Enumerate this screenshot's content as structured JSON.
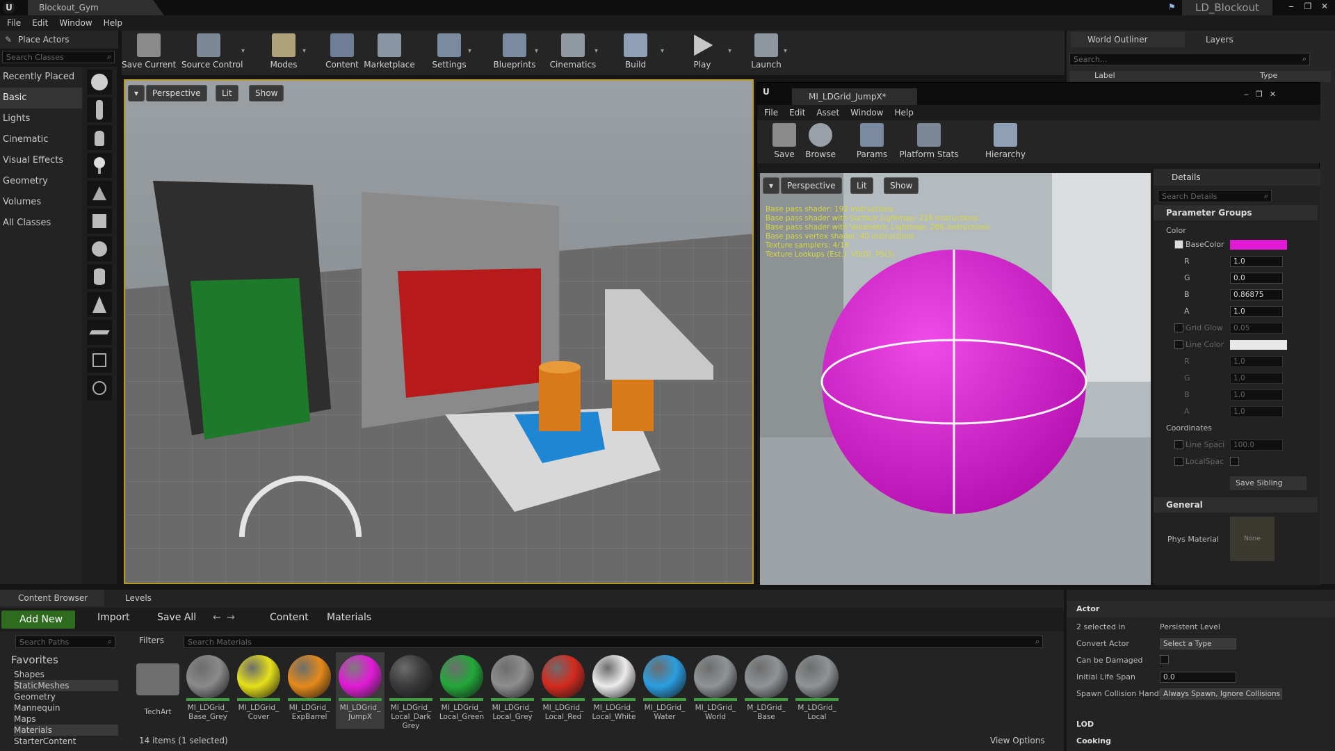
{
  "window": {
    "tab_title": "Blockout_Gym",
    "project": "LD_Blockout",
    "win_buttons": [
      "‒",
      "❐",
      "✕"
    ]
  },
  "menu": [
    "File",
    "Edit",
    "Window",
    "Help"
  ],
  "place_actors": {
    "title": "Place Actors",
    "search_placeholder": "Search Classes"
  },
  "categories": [
    "Recently Placed",
    "Basic",
    "Lights",
    "Cinematic",
    "Visual Effects",
    "Geometry",
    "Volumes",
    "All Classes"
  ],
  "toolbar": [
    "Save Current",
    "Source Control",
    "Modes",
    "Content",
    "Marketplace",
    "Settings",
    "Blueprints",
    "Cinematics",
    "Build",
    "Play",
    "Launch"
  ],
  "viewport": {
    "perspective": "Perspective",
    "lit": "Lit",
    "show": "Show"
  },
  "outliner": {
    "tab": "World Outliner",
    "layers": "Layers",
    "search_placeholder": "Search...",
    "col_label": "Label",
    "col_type": "Type"
  },
  "material_editor": {
    "tab_title": "MI_LDGrid_JumpX*",
    "menu": [
      "File",
      "Edit",
      "Asset",
      "Window",
      "Help"
    ],
    "toolbar": [
      "Save",
      "Browse",
      "Params",
      "Platform Stats",
      "Hierarchy"
    ],
    "viewport": {
      "perspective": "Perspective",
      "lit": "Lit",
      "show": "Show"
    },
    "stats": [
      "Base pass shader: 192 instructions",
      "Base pass shader with Surface Lightmap: 218 instructions",
      "Base pass shader with Volumetric Lightmap: 266 instructions",
      "Base pass vertex shader: 40 instructions",
      "Texture samplers: 4/16",
      "Texture Lookups (Est.): VS(0), PS(3)"
    ],
    "details": {
      "title": "Details",
      "search_placeholder": "Search Details",
      "parameter_groups": "Parameter Groups",
      "color": "Color",
      "basecolor_label": "BaseColor",
      "basecolor_hex": "#e21ad6",
      "r": "R",
      "g": "G",
      "b": "B",
      "a": "A",
      "basecolor": {
        "r": "1.0",
        "g": "0.0",
        "b": "0.86875",
        "a": "1.0"
      },
      "grid_glow": "Grid Glow",
      "grid_glow_value": "0.05",
      "line_color": "Line Color",
      "line_color_hex": "#e8e8e8",
      "line_rgba": {
        "r": "1.0",
        "g": "1.0",
        "b": "1.0",
        "a": "1.0"
      },
      "coordinates": "Coordinates",
      "line_spacing": "Line Spaci",
      "line_spacing_value": "100.0",
      "local_space": "LocalSpac",
      "save_sibling": "Save Sibling",
      "general": "General",
      "phys_material": "Phys Material",
      "phys_material_value": "None"
    }
  },
  "content_browser": {
    "tab": "Content Browser",
    "levels_tab": "Levels",
    "add_new": "Add New",
    "import": "Import",
    "save_all": "Save All",
    "path": [
      "Content",
      "Materials"
    ],
    "search_paths": "Search Paths",
    "filters": "Filters",
    "search_materials": "Search Materials",
    "favorites": "Favorites",
    "tree": [
      "Shapes",
      "StaticMeshes",
      "Geometry",
      "Mannequin",
      "Maps",
      "Materials",
      "StarterContent"
    ],
    "folder": "TechArt",
    "assets": [
      {
        "name": "MI_LDGrid_\nBase_Grey",
        "color": "#8a8a8a"
      },
      {
        "name": "MI_LDGrid_\nCover",
        "color": "#e6e01a"
      },
      {
        "name": "MI_LDGrid_\nExpBarrel",
        "color": "#e58a1a"
      },
      {
        "name": "MI_LDGrid_\nJumpX",
        "color": "#e21ad6"
      },
      {
        "name": "MI_LDGrid_\nLocal_Dark\nGrey",
        "color": "#3a3a3a"
      },
      {
        "name": "MI_LDGrid_\nLocal_Green",
        "color": "#22a83a"
      },
      {
        "name": "MI_LDGrid_\nLocal_Grey",
        "color": "#8e8e8e"
      },
      {
        "name": "MI_LDGrid_\nLocal_Red",
        "color": "#d42a1e"
      },
      {
        "name": "MI_LDGrid_\nLocal_White",
        "color": "#ececec"
      },
      {
        "name": "MI_LDGrid_\nWater",
        "color": "#2a9ee0"
      },
      {
        "name": "MI_LDGrid_\nWorld",
        "color": "#8f9497"
      },
      {
        "name": "M_LDGrid_\nBase",
        "color": "#8f9497"
      },
      {
        "name": "M_LDGrid_\nLocal",
        "color": "#8f9497"
      }
    ],
    "status": "14 items (1 selected)",
    "view_options": "View Options"
  },
  "actor_details": {
    "section": "Actor",
    "selected_key": "2 selected in",
    "selected_val": "Persistent Level",
    "convert_key": "Convert Actor",
    "convert_val": "Select a Type",
    "damage_key": "Can be Damaged",
    "life_key": "Initial Life Span",
    "life_val": "0.0",
    "spawn_key": "Spawn Collision Handli",
    "spawn_val": "Always Spawn, Ignore Collisions",
    "lod": "LOD",
    "cooking": "Cooking"
  }
}
